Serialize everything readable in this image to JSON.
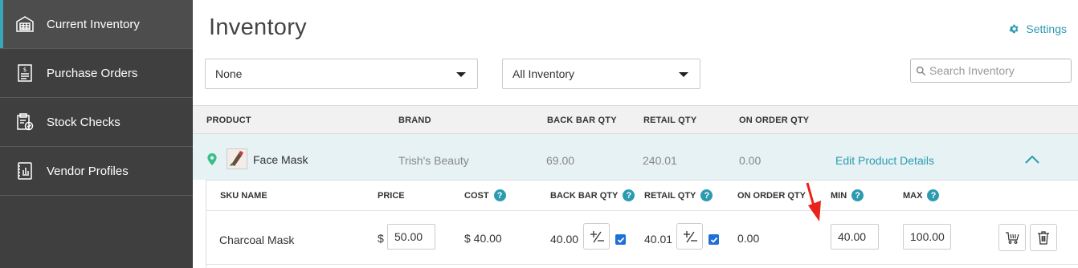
{
  "sidebar": {
    "items": [
      {
        "label": "Current Inventory",
        "icon": "warehouse-icon",
        "active": true
      },
      {
        "label": "Purchase Orders",
        "icon": "receipt-icon",
        "active": false
      },
      {
        "label": "Stock Checks",
        "icon": "clipboard-check-icon",
        "active": false
      },
      {
        "label": "Vendor Profiles",
        "icon": "vendor-icon",
        "active": false
      }
    ]
  },
  "header": {
    "title": "Inventory",
    "settings_label": "Settings"
  },
  "filters": {
    "brand_select": "None",
    "inventory_select": "All Inventory",
    "search_placeholder": "Search Inventory"
  },
  "table": {
    "columns": [
      "PRODUCT",
      "BRAND",
      "BACK BAR QTY",
      "RETAIL QTY",
      "ON ORDER QTY"
    ],
    "product": {
      "name": "Face Mask",
      "brand": "Trish's Beauty",
      "back_bar_qty": "69.00",
      "retail_qty": "240.01",
      "on_order_qty": "0.00",
      "edit_link": "Edit Product Details"
    }
  },
  "sku_table": {
    "columns": {
      "sku_name": "SKU NAME",
      "price": "PRICE",
      "cost": "COST",
      "back_bar_qty": "BACK BAR QTY",
      "retail_qty": "RETAIL QTY",
      "on_order_qty": "ON ORDER QTY",
      "min": "MIN",
      "max": "MAX"
    },
    "help_glyph": "?",
    "row": {
      "sku_name": "Charcoal Mask",
      "price_currency": "$",
      "price": "50.00",
      "cost": "$ 40.00",
      "back_bar_qty": "40.00",
      "retail_qty": "40.01",
      "on_order_qty": "0.00",
      "min": "40.00",
      "max": "100.00",
      "adjust_glyph": "+/−"
    }
  },
  "colors": {
    "sidebar_bg": "#3f3f3f",
    "accent": "#2c9bb0",
    "product_row_bg": "#e6f2f4",
    "checkbox": "#1f6fd6",
    "annotation_arrow": "#e8231c"
  }
}
